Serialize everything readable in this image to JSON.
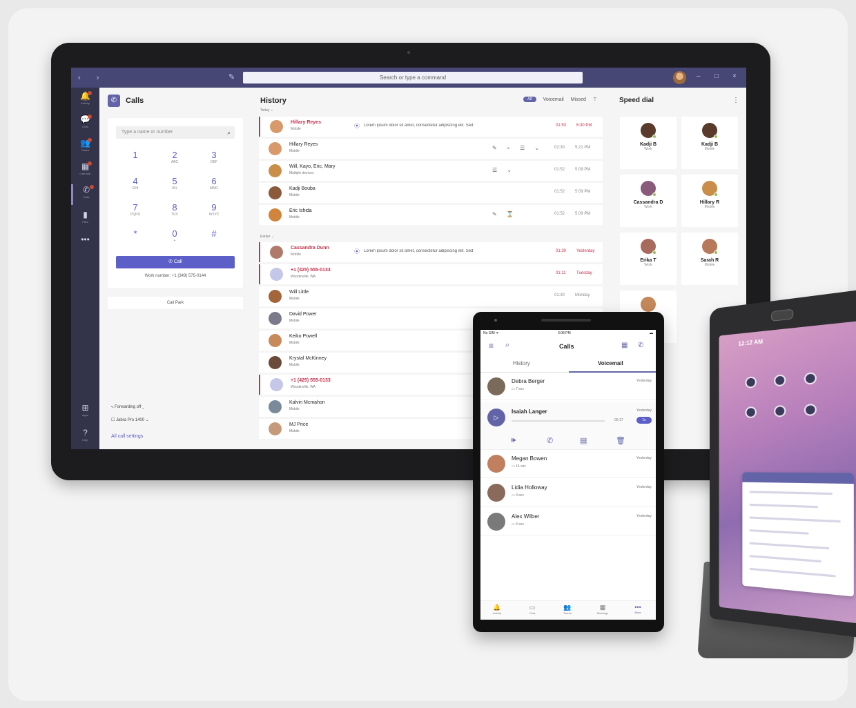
{
  "desktop": {
    "titlebar": {
      "nav": "‹ ›",
      "search_placeholder": "Search or type a command",
      "window_min": "–",
      "window_max": "□",
      "window_close": "×"
    },
    "rail": [
      {
        "label": "Activity",
        "icon": "bell-icon",
        "glyph": "🔔"
      },
      {
        "label": "Chat",
        "icon": "chat-icon",
        "glyph": "💬"
      },
      {
        "label": "Teams",
        "icon": "teams-icon",
        "glyph": "👥"
      },
      {
        "label": "Calendar",
        "icon": "calendar-icon",
        "glyph": "▦"
      },
      {
        "label": "Calls",
        "icon": "phone-icon",
        "glyph": "✆"
      },
      {
        "label": "Files",
        "icon": "file-icon",
        "glyph": "▮"
      },
      {
        "label": "",
        "icon": "more-icon",
        "glyph": "•••"
      },
      {
        "label": "Apps",
        "icon": "apps-icon",
        "glyph": "⊞"
      },
      {
        "label": "Help",
        "icon": "help-icon",
        "glyph": "?"
      }
    ],
    "calls": {
      "title": "Calls",
      "dial_placeholder": "Type a name or number",
      "keys": [
        {
          "d": "1",
          "l": ""
        },
        {
          "d": "2",
          "l": "ABC"
        },
        {
          "d": "3",
          "l": "DEF"
        },
        {
          "d": "4",
          "l": "GHI"
        },
        {
          "d": "5",
          "l": "JKL"
        },
        {
          "d": "6",
          "l": "MNO"
        },
        {
          "d": "7",
          "l": "PQRS"
        },
        {
          "d": "8",
          "l": "TUV"
        },
        {
          "d": "9",
          "l": "WXYZ"
        },
        {
          "d": "*",
          "l": ""
        },
        {
          "d": "0",
          "l": "+"
        },
        {
          "d": "#",
          "l": ""
        }
      ],
      "call_button": "Call",
      "work_number": "Work number: +1 (349) 575-0144",
      "call_park": "Call Park",
      "forwarding": "Forwarding off",
      "device": "Jabra Pro 1400",
      "all_settings": "All call settings"
    },
    "history": {
      "title": "History",
      "filters": [
        "All",
        "Voicemail",
        "Missed"
      ],
      "filter_icon": "filter-icon",
      "section_today": "Today",
      "section_earlier": "Earlier",
      "rows": [
        {
          "name": "Hillary Reyes",
          "sub": "Mobile",
          "missed": true,
          "msg": "Lorem ipsum dolor sit amet, consectetur adipiscing elit. Sed",
          "dur": "01:53",
          "time": "6:30 PM",
          "color": "#d89a6a"
        },
        {
          "name": "Hillary Reyes",
          "sub": "Mobile",
          "missed": false,
          "msg": "",
          "icons": "✎ ⌁ ☰ ⌄",
          "dur": "02:30",
          "time": "5:21 PM",
          "color": "#d89a6a"
        },
        {
          "name": "Will, Kayo, Eric, Mary",
          "sub": "Multiple devices",
          "missed": false,
          "msg": "",
          "icons": "☰ ⌄",
          "dur": "01:52",
          "time": "5:09 PM",
          "color": "#c98f4a"
        },
        {
          "name": "Kadji Bouba",
          "sub": "Mobile",
          "missed": false,
          "msg": "",
          "dur": "01:52",
          "time": "5:09 PM",
          "color": "#8a5a3a"
        },
        {
          "name": "Eric Ishida",
          "sub": "Mobile",
          "missed": false,
          "msg": "",
          "icons": "✎ ⌛",
          "dur": "01:52",
          "time": "5:09 PM",
          "color": "#d0843c"
        },
        {
          "name": "Cassandra Dunn",
          "sub": "Mobile",
          "missed": true,
          "msg": "Lorem ipsum dolor sit amet, consectetur adipiscing elit. Sed",
          "dur": "01:30",
          "time": "Yesterday",
          "color": "#b07a6a"
        },
        {
          "name": "+1 (425) 555-0133",
          "sub": "Woodinville, WA",
          "missed": true,
          "msg": "",
          "dur": "01:11",
          "time": "Tuesday",
          "color": "#c5c7e8"
        },
        {
          "name": "Will Little",
          "sub": "Mobile",
          "missed": false,
          "msg": "",
          "dur": "01:30",
          "time": "Monday",
          "color": "#a3653a"
        },
        {
          "name": "David Power",
          "sub": "Mobile",
          "missed": false,
          "msg": "",
          "dur": "",
          "time": "",
          "color": "#7a7a8a"
        },
        {
          "name": "Keiko Powell",
          "sub": "Mobile",
          "missed": false,
          "msg": "",
          "dur": "",
          "time": "",
          "color": "#c78a5a"
        },
        {
          "name": "Krystal McKinney",
          "sub": "Mobile",
          "missed": false,
          "msg": "",
          "dur": "",
          "time": "",
          "color": "#6a4a3a"
        },
        {
          "name": "+1 (425) 555-0133",
          "sub": "Woodinville, WA",
          "missed": true,
          "msg": "",
          "dur": "",
          "time": "",
          "color": "#c5c7e8"
        },
        {
          "name": "Kalvin Mcmahon",
          "sub": "Mobile",
          "missed": false,
          "msg": "",
          "dur": "",
          "time": "",
          "color": "#7a8a9a"
        },
        {
          "name": "MJ Price",
          "sub": "Mobile",
          "missed": false,
          "msg": "",
          "dur": "",
          "time": "",
          "color": "#c59a7a"
        }
      ]
    },
    "speed_dial": {
      "title": "Speed dial",
      "more": "⋮",
      "tiles": [
        {
          "name": "Kadji B",
          "kind": "Work",
          "color": "#5a3a2a"
        },
        {
          "name": "Kadji B",
          "kind": "Mobile",
          "color": "#5a3a2a"
        },
        {
          "name": "Cassandra D",
          "kind": "Work",
          "color": "#8a5a7a"
        },
        {
          "name": "Hillary R",
          "kind": "Mobile",
          "color": "#c98f4a"
        },
        {
          "name": "Erika T",
          "kind": "Work",
          "color": "#a86a5a"
        },
        {
          "name": "Sarah R",
          "kind": "Mobile",
          "color": "#b8785a"
        },
        {
          "name": "",
          "kind": "",
          "color": "#c4885a"
        }
      ]
    }
  },
  "phone": {
    "status_left": "No SIM ᯤ",
    "status_center": "3:08 PM",
    "status_right": "▬",
    "title": "Calls",
    "tabs": [
      "History",
      "Voicemail"
    ],
    "voicemails": [
      {
        "name": "Debra Berger",
        "dur": "▭ 7 sec",
        "time": "Yesterday",
        "color": "#7a6a5a"
      },
      {
        "name": "Megan Bowen",
        "dur": "▭ 14 sec",
        "time": "Yesterday",
        "color": "#c08060"
      },
      {
        "name": "Lidia Holloway",
        "dur": "▭ 9 sec",
        "time": "Yesterday",
        "color": "#8a6a5a"
      },
      {
        "name": "Alex Wilber",
        "dur": "▭ 4 sec",
        "time": "Yesterday",
        "color": "#7a7a7a"
      }
    ],
    "expanded": {
      "name": "Isaiah Langer",
      "time": "Yesterday",
      "length": "00:17",
      "speed": "1x",
      "progress": 0
    },
    "nav": [
      {
        "label": "Activity",
        "glyph": "🔔"
      },
      {
        "label": "Chat",
        "glyph": "▭"
      },
      {
        "label": "Teams",
        "glyph": "👥"
      },
      {
        "label": "Meetings",
        "glyph": "▦"
      },
      {
        "label": "More",
        "glyph": "•••"
      }
    ]
  },
  "display_device": {
    "time": "12:12 AM"
  },
  "colors": {
    "accent": "#6264a7",
    "missed": "#c4314b",
    "titlebar": "#464775",
    "rail": "#33344a"
  }
}
